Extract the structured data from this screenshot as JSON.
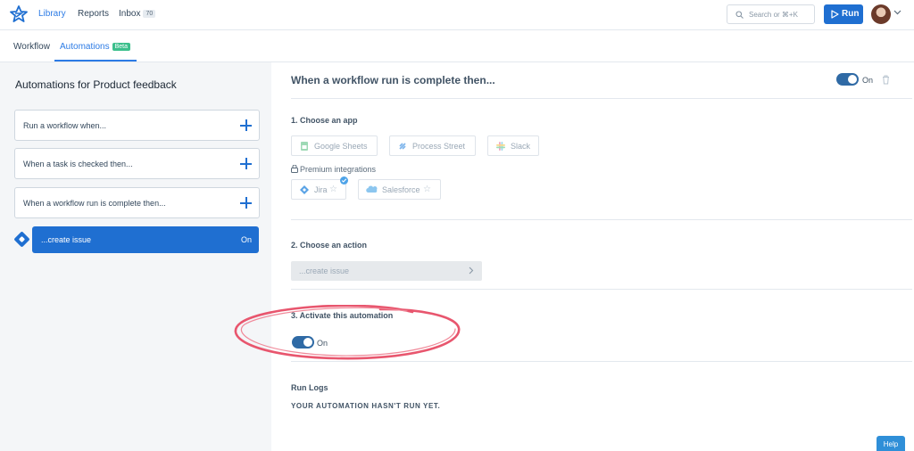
{
  "nav": {
    "links": [
      "Library",
      "Reports",
      "Inbox"
    ],
    "inbox_count": "70",
    "search_placeholder": "Search or ⌘+K",
    "run_label": "Run"
  },
  "tabs": {
    "workflow": "Workflow",
    "automations": "Automations",
    "beta": "Beta"
  },
  "sidebar": {
    "title": "Automations for Product feedback",
    "triggers": [
      "Run a workflow when...",
      "When a task is checked then...",
      "When a workflow run is complete then..."
    ],
    "selected_label": "...create issue",
    "selected_state": "On"
  },
  "detail": {
    "title": "When a workflow run is complete then...",
    "toggle_label": "On",
    "step1": "1. Choose an app",
    "apps": [
      "Google Sheets",
      "Process Street",
      "Slack"
    ],
    "premium_label": "Premium integrations",
    "premium_apps": [
      "Jira",
      "Salesforce"
    ],
    "step2": "2. Choose an action",
    "action_value": "...create issue",
    "step3": "3. Activate this automation",
    "activate_label": "On",
    "logs_title": "Run Logs",
    "logs_empty": "YOUR AUTOMATION HASN'T RUN YET."
  },
  "help_label": "Help",
  "colors": {
    "accent": "#1f6fd1",
    "toggle_on": "#2f6aa5",
    "beta_badge": "#3cbf8c",
    "annotation_ellipse": "#e8566e"
  }
}
